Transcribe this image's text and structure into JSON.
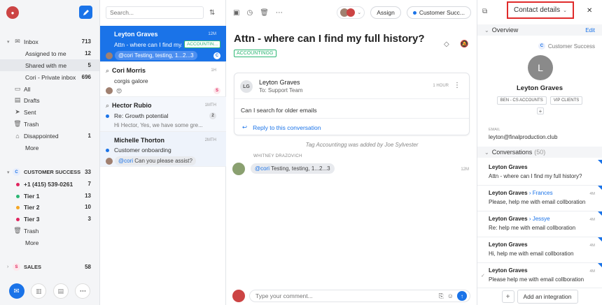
{
  "nav": {
    "inbox": {
      "label": "Inbox",
      "count": "713"
    },
    "assigned": {
      "label": "Assigned to me",
      "count": "12"
    },
    "shared": {
      "label": "Shared with me",
      "count": "5"
    },
    "private": {
      "label": "Cori - Private inbox",
      "count": "696"
    },
    "all": "All",
    "drafts": "Drafts",
    "sent": "Sent",
    "trash": "Trash",
    "disappointed": {
      "label": "Disappointed",
      "count": "1"
    },
    "more": "More",
    "cs": {
      "badge": "C",
      "label": "CUSTOMER SUCCESS",
      "count": "33"
    },
    "phone": {
      "label": "+1 (415) 539-0261",
      "count": "7"
    },
    "tier1": {
      "label": "Tier 1",
      "count": "13"
    },
    "tier2": {
      "label": "Tier 2",
      "count": "10"
    },
    "tier3": {
      "label": "Tier 3",
      "count": "3"
    },
    "cs_trash": "Trash",
    "cs_more": "More",
    "sales": {
      "badge": "S",
      "label": "SALES",
      "count": "58"
    },
    "colors": {
      "phone": "#e0245e",
      "tier1": "#2bb673",
      "tier2": "#f5a623",
      "tier3": "#e0245e"
    }
  },
  "list": {
    "search_placeholder": "Search...",
    "items": [
      {
        "name": "Leyton Graves",
        "time": "12M",
        "subject": "Attn - where can I find my...",
        "tag": "ACCOUNTIN...",
        "mention": "@cori",
        "preview": "Testing, testing, 1...2...3",
        "badge": "C"
      },
      {
        "name": "Cori Morris",
        "time": "1H",
        "subject": "corgis galore",
        "emoji": "😍",
        "badge": "S"
      },
      {
        "name": "Hector Rubio",
        "time": "1MTH",
        "subject": "Re: Growth potential",
        "preview": "Hi Hector, Yes, we have some gre...",
        "count": "2"
      },
      {
        "name": "Michelle Thorton",
        "time": "2MTH",
        "subject": "Customer onboarding",
        "mention": "@cori",
        "preview": "Can you please assist?"
      }
    ]
  },
  "conv": {
    "assign_label": "Assign",
    "inbox_label": "Customer Succ...",
    "subject": "Attn - where can I find my full history?",
    "tag": "ACCOUNTINGG",
    "message": {
      "initials": "LG",
      "from": "Leyton Graves",
      "to": "To: Support Team",
      "time": "1 HOUR",
      "body": "Can I search for older emails",
      "reply": "Reply to this conversation"
    },
    "activity": "Tag Accountingg was added by Joe Sylvester",
    "comment": {
      "author": "WHITNEY DRAZOVICH",
      "mention": "@cori",
      "text": "Testing, testing, 1...2...3",
      "time": "12M"
    },
    "composer_placeholder": "Type your comment..."
  },
  "side": {
    "title": "Contact details",
    "overview": "Overview",
    "edit": "Edit",
    "team_badge": "C",
    "team": "Customer Success",
    "avatar_letter": "L",
    "name": "Leyton Graves",
    "tags": [
      "BEN - CS ACCOUNTS",
      "VIP CLIENTS"
    ],
    "email_label": "EMAIL",
    "email": "leyton@finalproduction.club",
    "conversations": "Conversations",
    "conv_count": "(50)",
    "items": [
      {
        "name": "Leyton Graves",
        "to": "",
        "text": "Attn - where can I find my full history?",
        "time": ""
      },
      {
        "name": "Leyton Graves",
        "to": "Frances",
        "text": "Please, help me with email collboration",
        "time": "4M"
      },
      {
        "name": "Leyton Graves",
        "to": "Jessye",
        "text": "Re: help me with email collboration",
        "time": "4M"
      },
      {
        "name": "Leyton Graves",
        "to": "",
        "text": "Hi, help me with email collboration",
        "time": "4M"
      },
      {
        "name": "Leyton Graves",
        "to": "",
        "text": "Please help me with email collboration",
        "time": "4M"
      }
    ],
    "add_integration": "Add an integration"
  }
}
